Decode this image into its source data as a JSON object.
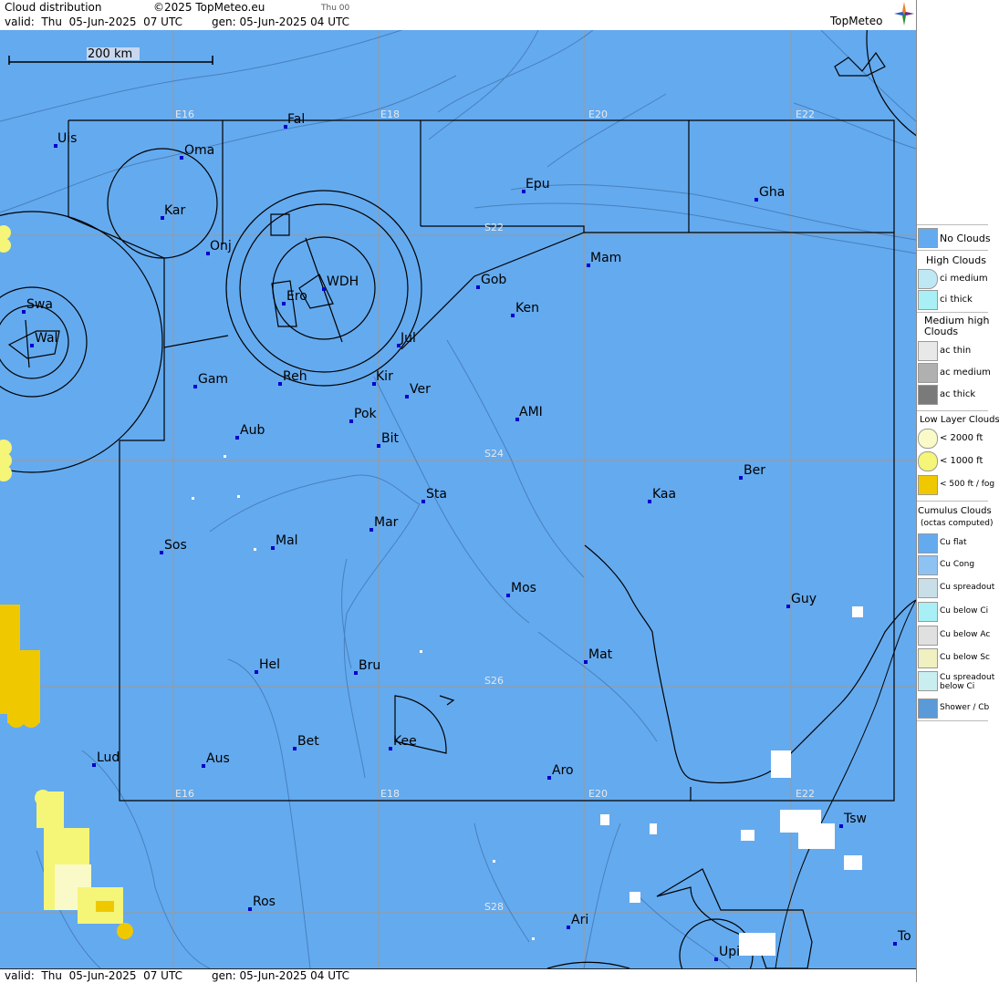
{
  "header": {
    "product": "Cloud distribution",
    "copyright": "©2025 TopMeteo.eu",
    "step": "Thu 00",
    "valid": "valid:  Thu  05-Jun-2025  07 UTC",
    "gen": "gen: 05-Jun-2025 04 UTC",
    "logo": "TopMeteo"
  },
  "footer": {
    "valid": "valid:  Thu  05-Jun-2025  07 UTC",
    "gen": "gen: 05-Jun-2025 04 UTC"
  },
  "scale": {
    "label": "200 km"
  },
  "grid_labels": {
    "e16_top": "E16",
    "e18_top": "E18",
    "e20_top": "E20",
    "e22_top": "E22",
    "s22": "S22",
    "s24": "S24",
    "s26": "S26",
    "s28": "S28",
    "e16_bot": "E16",
    "e18_bot": "E18",
    "e20_bot": "E20",
    "e22_bot": "E22"
  },
  "cities": [
    {
      "name": "Uis"
    },
    {
      "name": "Fal"
    },
    {
      "name": "Oma"
    },
    {
      "name": "Kar"
    },
    {
      "name": "Epu"
    },
    {
      "name": "Gha"
    },
    {
      "name": "Onj"
    },
    {
      "name": "Mam"
    },
    {
      "name": "Gob"
    },
    {
      "name": "Swa"
    },
    {
      "name": "Ero"
    },
    {
      "name": "WDH"
    },
    {
      "name": "Ken"
    },
    {
      "name": "Wal"
    },
    {
      "name": "Jul"
    },
    {
      "name": "Gam"
    },
    {
      "name": "Reh"
    },
    {
      "name": "Kir"
    },
    {
      "name": "Ver"
    },
    {
      "name": "Pok"
    },
    {
      "name": "AMI"
    },
    {
      "name": "Aub"
    },
    {
      "name": "Bit"
    },
    {
      "name": "Ber"
    },
    {
      "name": "Sta"
    },
    {
      "name": "Kaa"
    },
    {
      "name": "Mar"
    },
    {
      "name": "Sos"
    },
    {
      "name": "Mal"
    },
    {
      "name": "Mos"
    },
    {
      "name": "Guy"
    },
    {
      "name": "Mat"
    },
    {
      "name": "Hel"
    },
    {
      "name": "Bru"
    },
    {
      "name": "Bet"
    },
    {
      "name": "Kee"
    },
    {
      "name": "Lud"
    },
    {
      "name": "Aus"
    },
    {
      "name": "Aro"
    },
    {
      "name": "Tsw"
    },
    {
      "name": "Ros"
    },
    {
      "name": "Ari"
    },
    {
      "name": "To"
    },
    {
      "name": "Upi"
    }
  ],
  "legend": {
    "no_clouds": "No Clouds",
    "high_head": "High Clouds",
    "ci_medium": "ci medium",
    "ci_thick": "ci thick",
    "medium_head": "Medium high Clouds",
    "ac_thin": "ac thin",
    "ac_medium": "ac medium",
    "ac_thick": "ac thick",
    "low_head": "Low Layer Clouds",
    "low_2000": "< 2000 ft",
    "low_1000": "< 1000 ft",
    "low_500": "< 500 ft / fog",
    "cu_head": "Cumulus Clouds",
    "cu_sub": "(octas computed)",
    "cu_flat": "Cu flat",
    "cu_cong": "Cu Cong",
    "cu_spread": "Cu spreadout",
    "cu_below_ci": "Cu below Ci",
    "cu_below_ac": "Cu below Ac",
    "cu_below_sc": "Cu below Sc",
    "cu_spread_ci": "Cu spreadout below Ci",
    "shower": "Shower / Cb"
  },
  "colors": {
    "map_bg": "#64aaef",
    "grid": "#9a9a9a",
    "no_clouds": "#64aaef",
    "low_2000": "#fafac8",
    "low_1000": "#f5f578",
    "low_500": "#f0c800",
    "city_dot": "#0000cc"
  }
}
